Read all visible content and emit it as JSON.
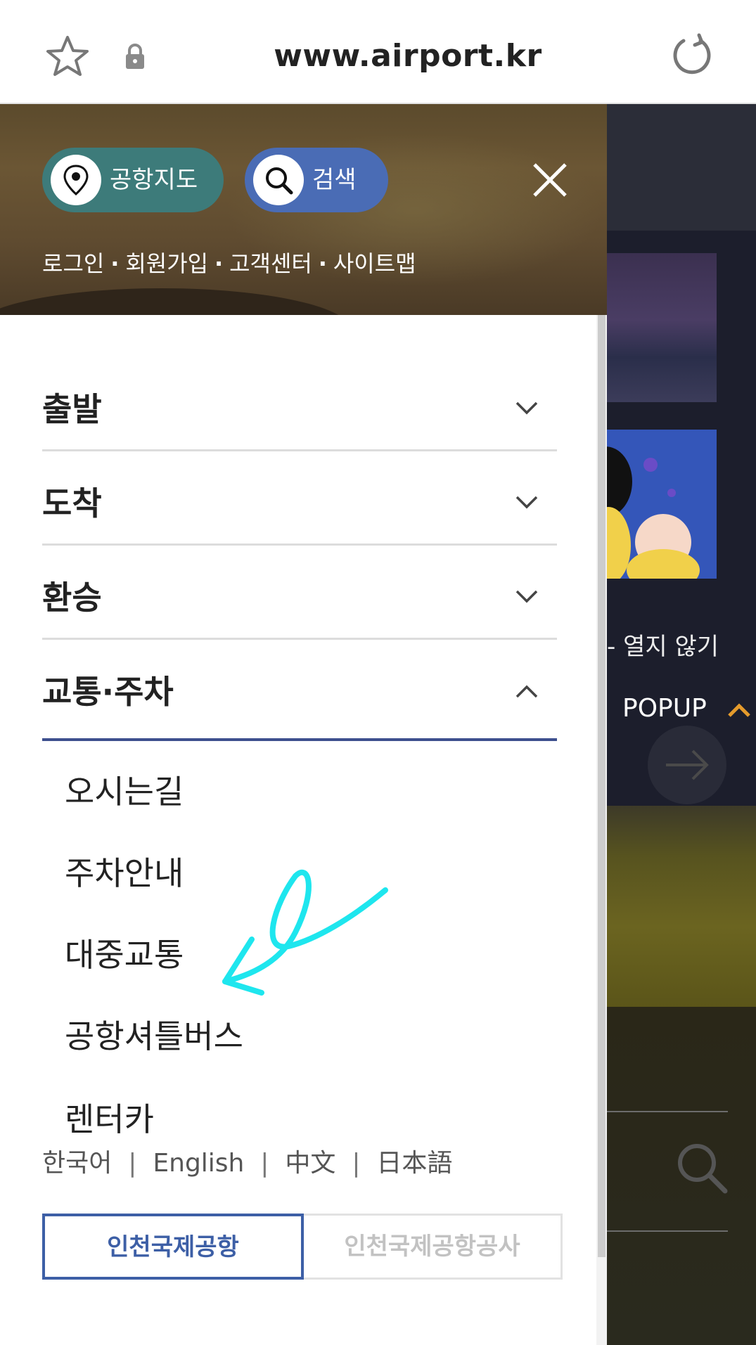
{
  "browser": {
    "url": "www.airport.kr"
  },
  "background_page": {
    "no_open_text": "- 열지 않기",
    "popup_label": "POPUP"
  },
  "drawer": {
    "map_button": "공항지도",
    "search_button": "검색",
    "user_links": [
      "로그인",
      "회원가입",
      "고객센터",
      "사이트맵"
    ],
    "menu": [
      {
        "label": "출발",
        "expanded": false
      },
      {
        "label": "도착",
        "expanded": false
      },
      {
        "label": "환승",
        "expanded": false
      },
      {
        "label": "교통·주차",
        "expanded": true
      }
    ],
    "submenu": [
      "오시는길",
      "주차안내",
      "대중교통",
      "공항셔틀버스",
      "렌터카"
    ],
    "languages": [
      "한국어",
      "English",
      "中文",
      "日本語"
    ],
    "site_tabs": [
      {
        "label": "인천국제공항",
        "selected": true
      },
      {
        "label": "인천국제공항공사",
        "selected": false
      }
    ]
  },
  "colors": {
    "accent_blue": "#3d5fa6",
    "map_pill": "#3d7b7a",
    "search_pill": "#4a6cb5",
    "annotation": "#1ee6ee"
  }
}
